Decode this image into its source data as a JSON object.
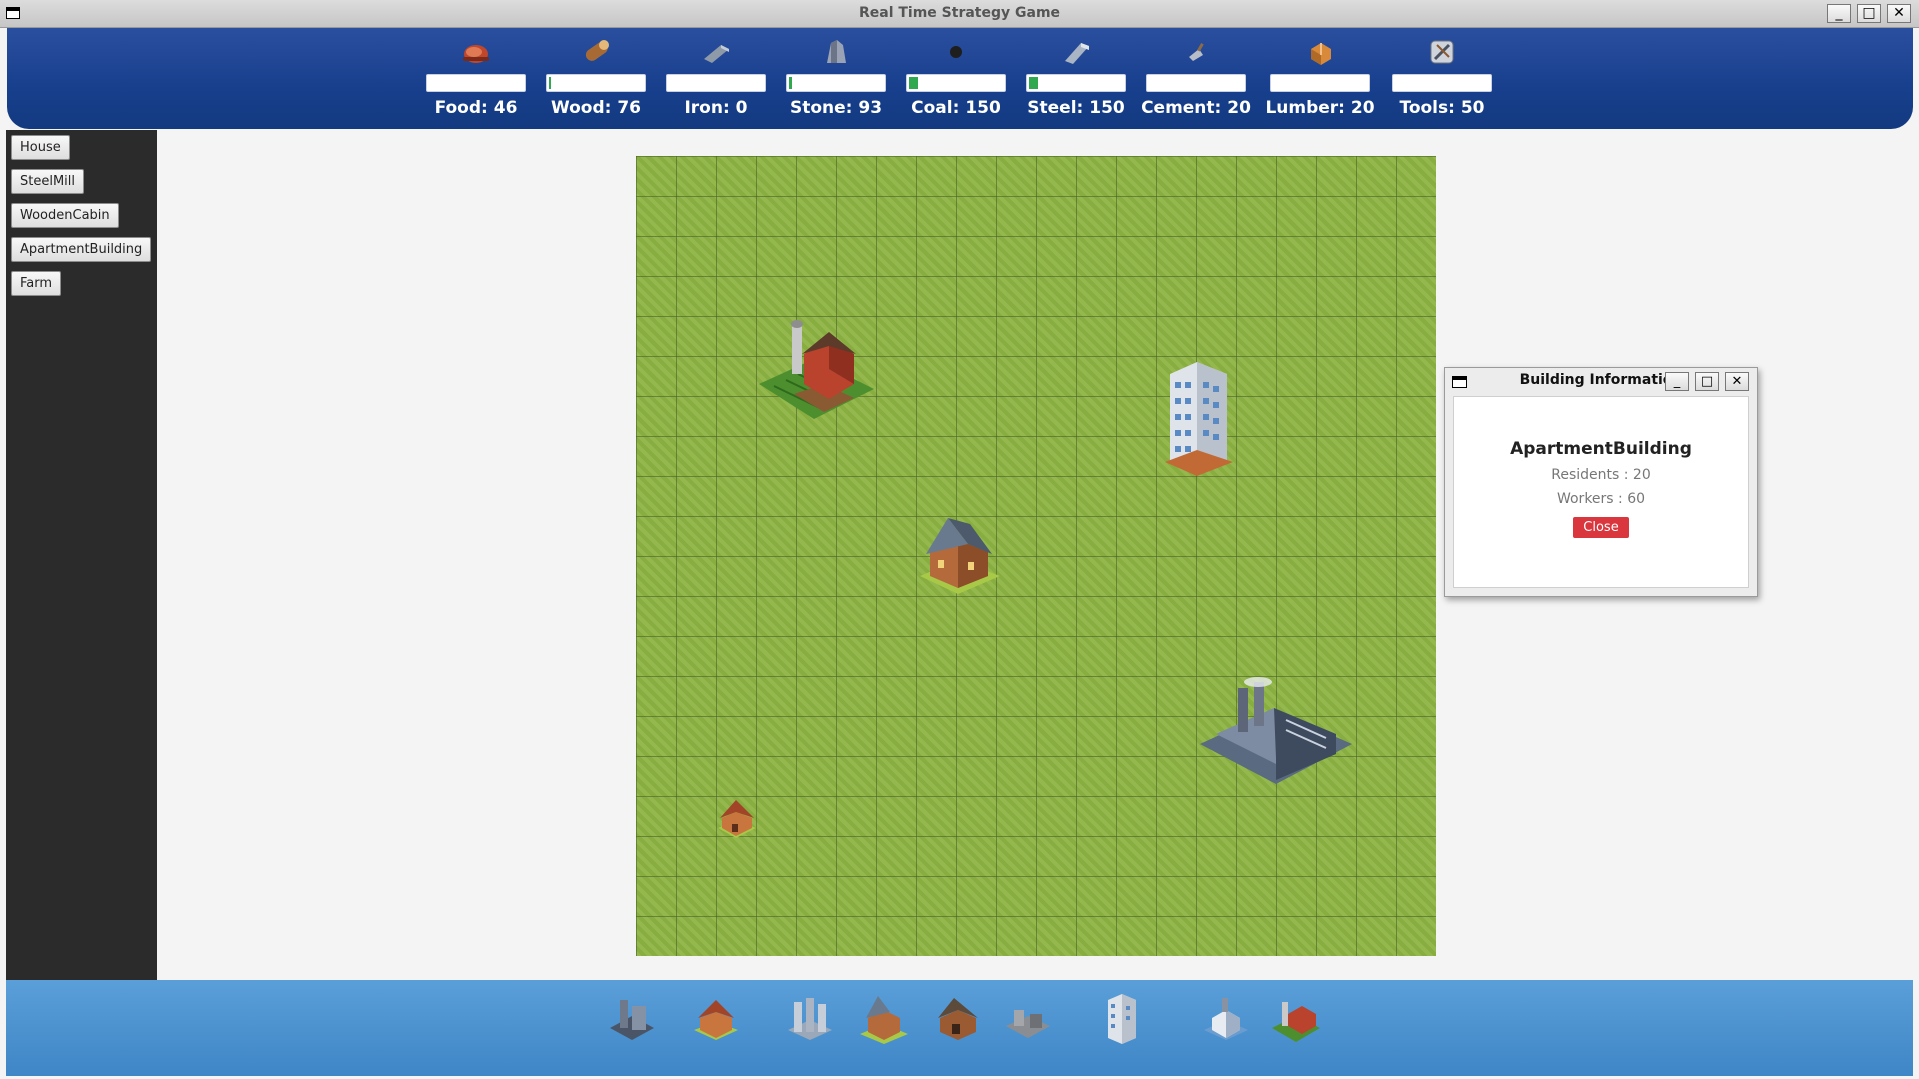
{
  "window": {
    "title": "Real Time Strategy Game",
    "buttons": [
      "_",
      "□",
      "✕"
    ]
  },
  "resources": [
    {
      "name": "Food",
      "label": "Food: 46",
      "icon": "meat-icon",
      "fill": 0.0,
      "color": "#c85a3c"
    },
    {
      "name": "Wood",
      "label": "Wood: 76",
      "icon": "log-icon",
      "fill": 0.02,
      "color": "#c68a4a"
    },
    {
      "name": "Iron",
      "label": "Iron: 0",
      "icon": "iron-bar-icon",
      "fill": 0.0,
      "color": "#8f9aa8"
    },
    {
      "name": "Stone",
      "label": "Stone: 93",
      "icon": "stone-icon",
      "fill": 0.02,
      "color": "#9aa3b5"
    },
    {
      "name": "Coal",
      "label": "Coal: 150",
      "icon": "coal-icon",
      "fill": 0.09,
      "color": "#1e1e1e"
    },
    {
      "name": "Steel",
      "label": "Steel: 150",
      "icon": "steel-bar-icon",
      "fill": 0.09,
      "color": "#a9b4c4"
    },
    {
      "name": "Cement",
      "label": "Cement: 20",
      "icon": "trowel-icon",
      "fill": 0.0,
      "color": "#b8bec8"
    },
    {
      "name": "Lumber",
      "label": "Lumber: 20",
      "icon": "lumber-icon",
      "fill": 0.0,
      "color": "#d88a3a"
    },
    {
      "name": "Tools",
      "label": "Tools: 50",
      "icon": "tools-icon",
      "fill": 0.0,
      "color": "#cfd4dc"
    }
  ],
  "sidebar": {
    "buttons": [
      "House",
      "SteelMill",
      "WoodenCabin",
      "ApartmentBuilding",
      "Farm"
    ]
  },
  "map": {
    "buildings": [
      "Farm",
      "ApartmentBuilding",
      "WoodenCabin",
      "SteelMill",
      "House"
    ]
  },
  "dialog": {
    "title": "Building Information",
    "building_name": "ApartmentBuilding",
    "residents": "Residents : 20",
    "workers": "Workers : 60",
    "close_label": "Close"
  },
  "toolbar": {
    "items": [
      "steel-mill-icon",
      "house-icon",
      "factory-icon",
      "wooden-cabin-icon",
      "cabin-icon",
      "ruins-icon",
      "apartment-building-icon",
      "mill-icon",
      "farm-icon"
    ]
  }
}
